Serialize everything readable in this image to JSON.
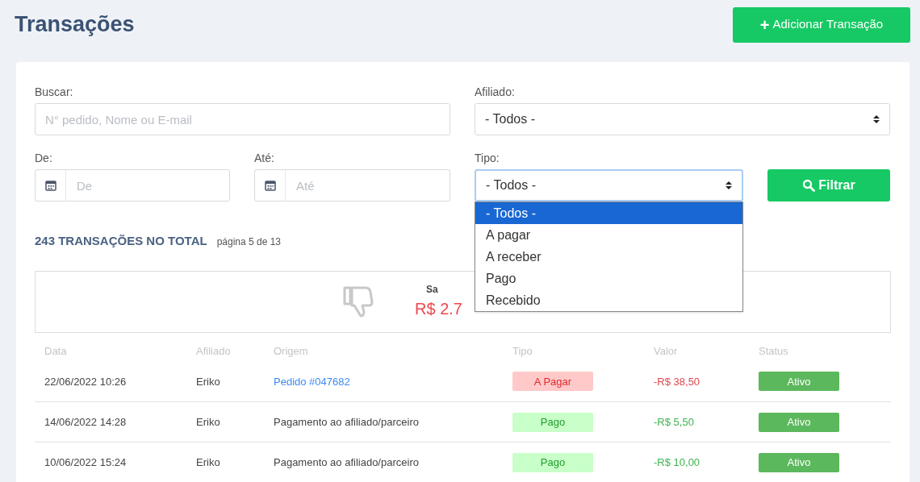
{
  "title": "Transações",
  "add_button": {
    "icon": "+",
    "label": "Adicionar Transação"
  },
  "filters": {
    "search": {
      "label": "Buscar:",
      "placeholder": "N° pedido, Nome ou E-mail"
    },
    "affiliate": {
      "label": "Afiliado:",
      "value": "- Todos -"
    },
    "from": {
      "label": "De:",
      "placeholder": "De"
    },
    "to": {
      "label": "Até:",
      "placeholder": "Até"
    },
    "type": {
      "label": "Tipo:",
      "value": "- Todos -",
      "expanded": true,
      "options": [
        {
          "label": "- Todos -",
          "selected": true
        },
        {
          "label": "A pagar",
          "selected": false
        },
        {
          "label": "A receber",
          "selected": false
        },
        {
          "label": "Pago",
          "selected": false
        },
        {
          "label": "Recebido",
          "selected": false
        }
      ]
    },
    "filter_button": "Filtrar"
  },
  "total": "243 TRANSAÇÕES NO TOTAL",
  "page": "página 5 de 13",
  "summary": {
    "label": "Sa",
    "value": "R$ 2.7"
  },
  "table": {
    "columns": [
      "Data",
      "Afiliado",
      "Origem",
      "Tipo",
      "Valor",
      "Status"
    ],
    "rows": [
      {
        "date": "22/06/2022 10:26",
        "affiliate": "Eriko",
        "origin": {
          "kind": "link",
          "text": "Pedido #047682"
        },
        "type": {
          "kind": "payable",
          "label": "A Pagar"
        },
        "value": "-R$ 38,50",
        "status": "Ativo"
      },
      {
        "date": "14/06/2022 14:28",
        "affiliate": "Eriko",
        "origin": {
          "kind": "text",
          "text": "Pagamento ao afiliado/parceiro"
        },
        "type": {
          "kind": "paid",
          "label": "Pago"
        },
        "value": "-R$ 5,50",
        "status": "Ativo"
      },
      {
        "date": "10/06/2022 15:24",
        "affiliate": "Eriko",
        "origin": {
          "kind": "text",
          "text": "Pagamento ao afiliado/parceiro"
        },
        "type": {
          "kind": "paid",
          "label": "Pago"
        },
        "value": "-R$ 10,00",
        "status": "Ativo"
      }
    ]
  }
}
